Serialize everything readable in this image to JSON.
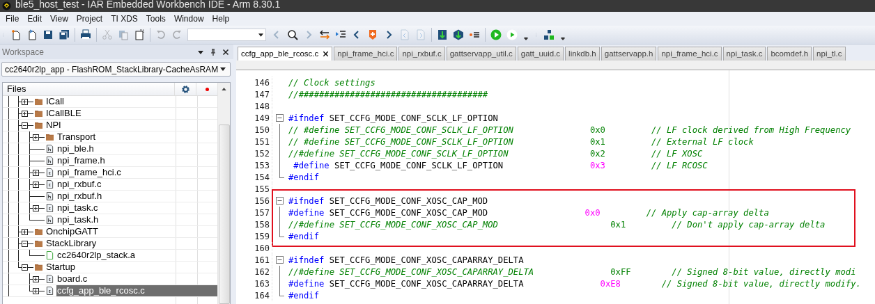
{
  "window": {
    "title": "ble5_host_test - IAR Embedded Workbench IDE - Arm 8.30.1"
  },
  "menu": [
    "File",
    "Edit",
    "View",
    "Project",
    "TI XDS",
    "Tools",
    "Window",
    "Help"
  ],
  "toolbar": [
    {
      "kind": "grip"
    },
    {
      "kind": "new",
      "disabled": false
    },
    {
      "kind": "open",
      "disabled": false
    },
    {
      "kind": "save",
      "disabled": false
    },
    {
      "kind": "save-all",
      "disabled": false
    },
    {
      "kind": "separator"
    },
    {
      "kind": "print",
      "disabled": false
    },
    {
      "kind": "separator"
    },
    {
      "kind": "cut",
      "disabled": true
    },
    {
      "kind": "copy",
      "disabled": true
    },
    {
      "kind": "paste",
      "disabled": false
    },
    {
      "kind": "separator"
    },
    {
      "kind": "undo",
      "disabled": true
    },
    {
      "kind": "redo",
      "disabled": true
    },
    {
      "kind": "combo"
    },
    {
      "kind": "back",
      "disabled": true
    },
    {
      "kind": "find",
      "disabled": false
    },
    {
      "kind": "forward",
      "disabled": true
    },
    {
      "kind": "swap",
      "disabled": false
    },
    {
      "kind": "step-list",
      "disabled": false
    },
    {
      "kind": "prev",
      "disabled": false
    },
    {
      "kind": "bookmark",
      "disabled": false
    },
    {
      "kind": "next",
      "disabled": false
    },
    {
      "kind": "prev-doc",
      "disabled": true
    },
    {
      "kind": "next-doc",
      "disabled": true
    },
    {
      "kind": "separator"
    },
    {
      "kind": "download",
      "disabled": false
    },
    {
      "kind": "download-hex",
      "disabled": false
    },
    {
      "kind": "breakpoint-list",
      "disabled": false
    },
    {
      "kind": "separator"
    },
    {
      "kind": "go",
      "disabled": false
    },
    {
      "kind": "run",
      "disabled": false
    },
    {
      "kind": "overflow"
    },
    {
      "kind": "grip"
    },
    {
      "kind": "blocks",
      "disabled": false
    },
    {
      "kind": "overflow"
    }
  ],
  "workspace": {
    "title": "Workspace",
    "configuration": "cc2640r2lp_app - FlashROM_StackLibrary-CacheAsRAM",
    "files_header": "Files",
    "items": [
      {
        "label": "ICall",
        "kind": "folder",
        "expanded": false,
        "selected": false
      },
      {
        "label": "ICallBLE",
        "kind": "folder",
        "expanded": false,
        "selected": false
      },
      {
        "label": "NPI",
        "kind": "folder",
        "expanded": true,
        "selected": false,
        "children": [
          {
            "label": "Transport",
            "kind": "folder",
            "expanded": false,
            "selected": false
          },
          {
            "label": "npi_ble.h",
            "kind": "header",
            "selected": false
          },
          {
            "label": "npi_frame.h",
            "kind": "header",
            "selected": false
          },
          {
            "label": "npi_frame_hci.c",
            "kind": "source",
            "expanded": false,
            "selected": false
          },
          {
            "label": "npi_rxbuf.c",
            "kind": "source",
            "expanded": false,
            "selected": false
          },
          {
            "label": "npi_rxbuf.h",
            "kind": "header",
            "selected": false
          },
          {
            "label": "npi_task.c",
            "kind": "source",
            "expanded": false,
            "selected": false
          },
          {
            "label": "npi_task.h",
            "kind": "header",
            "selected": false
          }
        ]
      },
      {
        "label": "OnchipGATT",
        "kind": "folder",
        "expanded": false,
        "selected": false
      },
      {
        "label": "StackLibrary",
        "kind": "folder",
        "expanded": true,
        "selected": false,
        "children": [
          {
            "label": "cc2640r2lp_stack.a",
            "kind": "library",
            "selected": false
          }
        ]
      },
      {
        "label": "Startup",
        "kind": "folder",
        "expanded": true,
        "selected": false,
        "children": [
          {
            "label": "board.c",
            "kind": "source",
            "expanded": false,
            "selected": false
          },
          {
            "label": "ccfg_app_ble_rcosc.c",
            "kind": "source",
            "expanded": false,
            "selected": true
          }
        ]
      }
    ]
  },
  "tabs": [
    {
      "label": "ccfg_app_ble_rcosc.c",
      "selected": true
    },
    {
      "label": "npi_frame_hci.c",
      "selected": false
    },
    {
      "label": "npi_rxbuf.c",
      "selected": false
    },
    {
      "label": "gattservapp_util.c",
      "selected": false
    },
    {
      "label": "gatt_uuid.c",
      "selected": false
    },
    {
      "label": "linkdb.h",
      "selected": false
    },
    {
      "label": "gattservapp.h",
      "selected": false
    },
    {
      "label": "npi_frame_hci.c",
      "selected": false
    },
    {
      "label": "npi_task.c",
      "selected": false
    },
    {
      "label": "bcomdef.h",
      "selected": false
    },
    {
      "label": "npi_tl.c",
      "selected": false
    }
  ],
  "code_lines": [
    {
      "number": "146",
      "tokens": [
        {
          "kind": "comment",
          "text": "// Clock settings"
        }
      ]
    },
    {
      "number": "147",
      "tokens": [
        {
          "kind": "comment",
          "text": "//#####################################"
        }
      ]
    },
    {
      "number": "148"
    },
    {
      "number": "149",
      "highlighted": false,
      "tokens": [
        {
          "kind": "directive",
          "text": "#ifndef"
        },
        {
          "kind": "plain",
          "text": " SET_CCFG_MODE_CONF_SCLK_LF_OPTION"
        }
      ],
      "children": [
        {
          "number": "150",
          "tokens": [
            {
              "kind": "comment",
              "text": "// #define SET_CCFG_MODE_CONF_SCLK_LF_OPTION               "
            },
            {
              "kind": "dim",
              "text": "0x0         "
            },
            {
              "kind": "comment",
              "text": "// LF clock derived from High Frequency"
            }
          ]
        },
        {
          "number": "151",
          "tokens": [
            {
              "kind": "comment",
              "text": "// #define SET_CCFG_MODE_CONF_SCLK_LF_OPTION               "
            },
            {
              "kind": "dim",
              "text": "0x1         "
            },
            {
              "kind": "comment",
              "text": "// External LF clock"
            }
          ]
        },
        {
          "number": "152",
          "tokens": [
            {
              "kind": "comment",
              "text": "//#define SET_CCFG_MODE_CONF_SCLK_LF_OPTION                "
            },
            {
              "kind": "dim",
              "text": "0x2         "
            },
            {
              "kind": "comment",
              "text": "// LF XOSC"
            }
          ]
        },
        {
          "number": "153",
          "tokens": [
            {
              "kind": "directive",
              "text": " #define"
            },
            {
              "kind": "plain",
              "text": " SET_CCFG_MODE_CONF_SCLK_LF_OPTION                 "
            },
            {
              "kind": "number",
              "text": "0x3         "
            },
            {
              "kind": "comment",
              "text": "// LF RCOSC"
            }
          ]
        },
        {
          "number": "154",
          "tokens": [
            {
              "kind": "directive",
              "text": "#endif"
            }
          ]
        }
      ]
    },
    {
      "number": "155"
    },
    {
      "number": "156",
      "highlighted": true,
      "tokens": [
        {
          "kind": "directive",
          "text": "#ifndef"
        },
        {
          "kind": "plain",
          "text": " SET_CCFG_MODE_CONF_XOSC_CAP_MOD"
        }
      ],
      "children": [
        {
          "number": "157",
          "tokens": [
            {
              "kind": "directive",
              "text": "#define"
            },
            {
              "kind": "plain",
              "text": " SET_CCFG_MODE_CONF_XOSC_CAP_MOD                   "
            },
            {
              "kind": "number",
              "text": "0x0         "
            },
            {
              "kind": "comment",
              "text": "// Apply cap-array delta"
            }
          ]
        },
        {
          "number": "158",
          "tokens": [
            {
              "kind": "comment",
              "text": "//#define SET_CCFG_MODE_CONF_XOSC_CAP_MOD                      "
            },
            {
              "kind": "dim",
              "text": "0x1         "
            },
            {
              "kind": "comment",
              "text": "// Don't apply cap-array delta"
            }
          ]
        },
        {
          "number": "159",
          "tokens": [
            {
              "kind": "directive",
              "text": "#endif"
            }
          ]
        }
      ]
    },
    {
      "number": "160"
    },
    {
      "number": "161",
      "highlighted": false,
      "tokens": [
        {
          "kind": "directive",
          "text": "#ifndef"
        },
        {
          "kind": "plain",
          "text": " SET_CCFG_MODE_CONF_XOSC_CAPARRAY_DELTA"
        }
      ],
      "children": [
        {
          "number": "162",
          "tokens": [
            {
              "kind": "comment",
              "text": "//#define SET_CCFG_MODE_CONF_XOSC_CAPARRAY_DELTA               "
            },
            {
              "kind": "dim",
              "text": "0xFF        "
            },
            {
              "kind": "comment",
              "text": "// Signed 8-bit value, directly modi"
            }
          ]
        },
        {
          "number": "163",
          "tokens": [
            {
              "kind": "directive",
              "text": "#define"
            },
            {
              "kind": "plain",
              "text": " SET_CCFG_MODE_CONF_XOSC_CAPARRAY_DELTA               "
            },
            {
              "kind": "number",
              "text": "0xE8        "
            },
            {
              "kind": "comment",
              "text": "// Signed 8-bit value, directly modify."
            }
          ]
        },
        {
          "number": "164",
          "tokens": [
            {
              "kind": "directive",
              "text": "#endif"
            }
          ]
        }
      ]
    }
  ]
}
